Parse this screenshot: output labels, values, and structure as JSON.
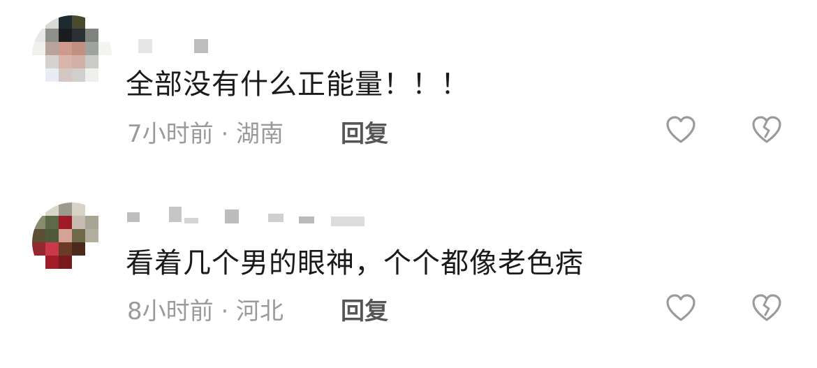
{
  "comments": [
    {
      "text": "全部没有什么正能量！！！",
      "time": "7小时前",
      "location": "湖南",
      "meta": "7小时前 · 湖南",
      "reply_label": "回复",
      "avatar_pixels": [
        [
          "#ffffff",
          "#d9dad6",
          "#1d2a2e",
          "#4a4a2e",
          "#ffffff",
          "#ffffff"
        ],
        [
          "#e8e8e6",
          "#8d918a",
          "#1a1d20",
          "#2a3034",
          "#7f837e",
          "#ffffff"
        ],
        [
          "#f0f0ee",
          "#b8a49a",
          "#cf9a8d",
          "#c3907f",
          "#9ea39e",
          "#f4f4f2"
        ],
        [
          "#ffffff",
          "#d6d2cf",
          "#dab5ab",
          "#d2b0a5",
          "#cacbc6",
          "#ffffff"
        ],
        [
          "#ffffff",
          "#e9ecf4",
          "#d4c7c3",
          "#cfcfcc",
          "#eff0ee",
          "#ffffff"
        ],
        [
          "#ffffff",
          "#ffffff",
          "#ffffff",
          "#ffffff",
          "#ffffff",
          "#ffffff"
        ]
      ],
      "username_blocks": [
        "#e6e6e6",
        "#bdbdbd"
      ]
    },
    {
      "text": "看着几个男的眼神，个个都像老色痞",
      "time": "8小时前",
      "location": "河北",
      "meta": "8小时前 · 河北",
      "reply_label": "回复",
      "avatar_pixels": [
        [
          "#ffffff",
          "#d9d6c8",
          "#9a9b8e",
          "#d7d3c6",
          "#ffffff",
          "#ffffff"
        ],
        [
          "#8b8c6f",
          "#5d6a48",
          "#a01b28",
          "#c6bcb0",
          "#a7a596",
          "#ffffff"
        ],
        [
          "#5b4f35",
          "#4f5a3a",
          "#d6a296",
          "#6e6a47",
          "#b2ad9c",
          "#ffffff"
        ],
        [
          "#93292f",
          "#c9394a",
          "#6b3b26",
          "#4b2a1c",
          "#ffffff",
          "#ffffff"
        ],
        [
          "#ffffff",
          "#a51a29",
          "#7a1a1f",
          "#ffffff",
          "#ffffff",
          "#ffffff"
        ],
        [
          "#ffffff",
          "#ffffff",
          "#ffffff",
          "#ffffff",
          "#ffffff",
          "#ffffff"
        ]
      ],
      "username_blocks": [
        "#bdbdbd",
        "#c6c6c6",
        "#d4d4d4",
        "#bcbcbc",
        "#cfcfcf",
        "#bababa",
        "#dcdcdc"
      ]
    }
  ],
  "colors": {
    "text": "#1a1a1a",
    "meta": "#9a9a9a",
    "reply": "#555555",
    "icon_stroke": "#9a9a9a"
  },
  "icons": {
    "like": "heart-outline-icon",
    "dislike": "broken-heart-outline-icon"
  }
}
